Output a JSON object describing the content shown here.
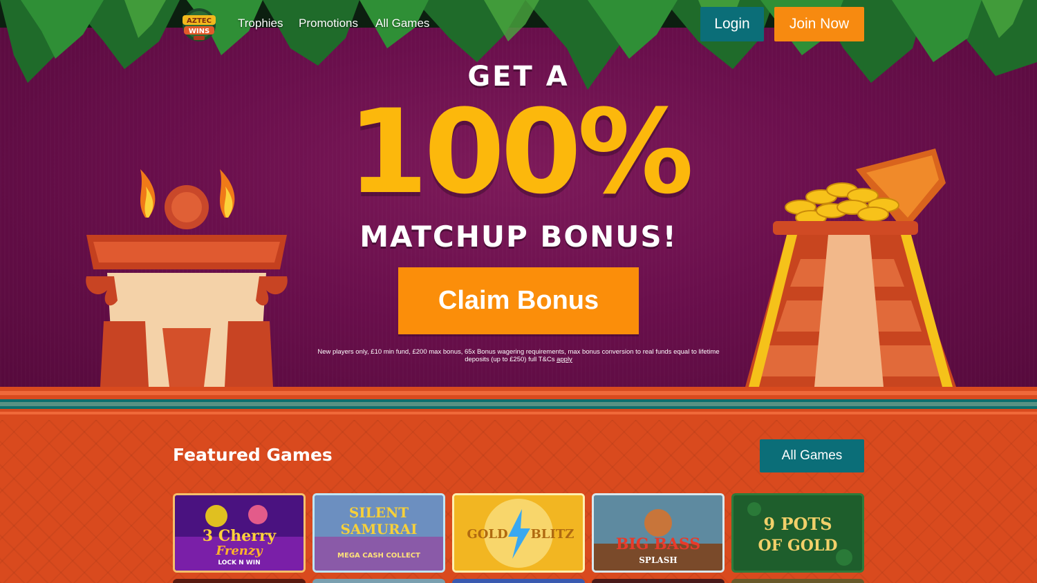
{
  "nav": {
    "logo_text_top": "AZTEC",
    "logo_text_bottom": "WINS",
    "links": [
      "Trophies",
      "Promotions",
      "All Games"
    ],
    "login": "Login",
    "join": "Join Now"
  },
  "hero": {
    "line1": "GET A",
    "line2": "100%",
    "line3": "MATCHUP BONUS!",
    "cta": "Claim Bonus",
    "terms": "New players only, £10 min fund, £200 max bonus, 65x Bonus wagering requirements, max bonus conversion to real funds equal to lifetime deposits (up to £250) full T&Cs",
    "terms_link": "apply"
  },
  "featured": {
    "title": "Featured Games",
    "all_games": "All Games",
    "games": [
      {
        "title_a": "3 Cherry",
        "title_b": "Frenzy",
        "title_c": "LOCK N WIN"
      },
      {
        "title_a": "SILENT",
        "title_b": "SAMURAI",
        "title_c": "MEGA CASH COLLECT"
      },
      {
        "title_a": "GOLD",
        "title_b": "BLITZ",
        "title_c": ""
      },
      {
        "title_a": "BIG BASS",
        "title_b": "SPLASH",
        "title_c": ""
      },
      {
        "title_a": "9 POTS",
        "title_b": "OF GOLD",
        "title_c": ""
      }
    ]
  },
  "colors": {
    "hero_bg": "#6a0f4c",
    "teal_button": "#0b6e78",
    "orange_button": "#f78a10",
    "headline_gold": "#fcb80c",
    "section_orange": "#d94a1e"
  }
}
